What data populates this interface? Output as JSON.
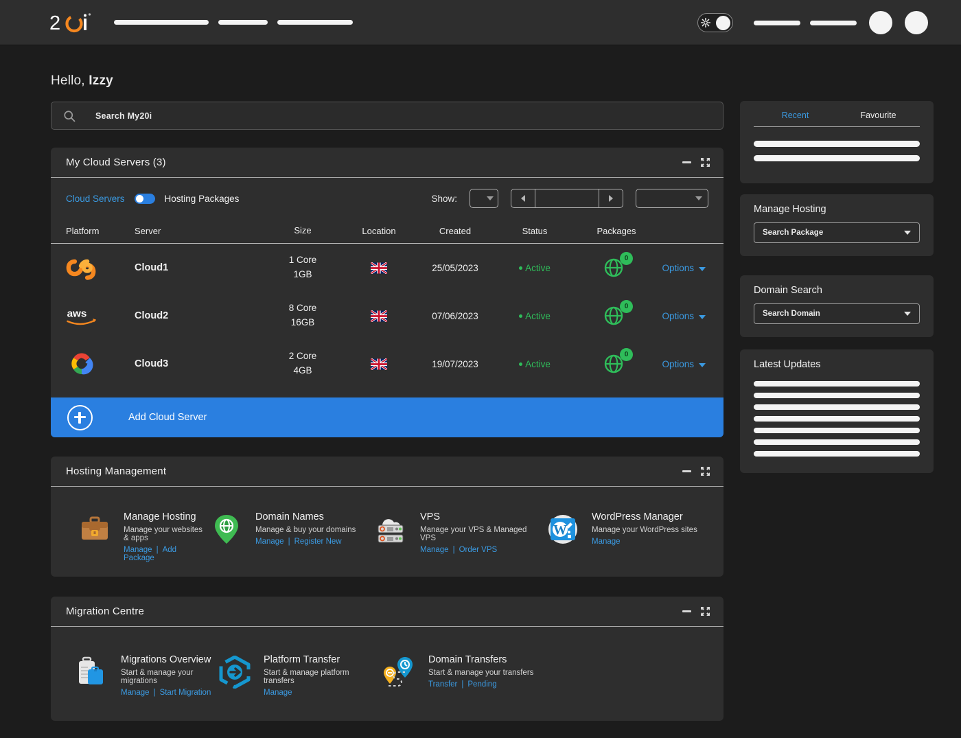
{
  "brand": {
    "logo_text": "20i",
    "accent_orange": "#F5871F",
    "accent_blue": "#2A7FE0"
  },
  "topbar": {
    "nav_placeholder_widths": [
      138,
      72,
      110
    ],
    "right_placeholder_widths": [
      68,
      68
    ],
    "theme_toggle_name": "theme-toggle",
    "avatars": 2
  },
  "greeting": {
    "prefix": "Hello, ",
    "name": "Izzy"
  },
  "search": {
    "placeholder": "Search My20i",
    "value": ""
  },
  "cloud_panel": {
    "title": "My Cloud Servers (3)",
    "toggle_left_label": "Cloud Servers",
    "toggle_right_label": "Hosting Packages",
    "show_label": "Show:",
    "show_value": "",
    "page_value": "",
    "filter_value": "",
    "columns": [
      "Platform",
      "Server",
      "Size",
      "Location",
      "Created",
      "Status",
      "Packages"
    ],
    "rows": [
      {
        "platform": "twentyi-cloud",
        "server": "Cloud1",
        "cores": "1 Core",
        "ram": "1GB",
        "location": "GB",
        "created": "25/05/2023",
        "status": "Active",
        "packages": "0",
        "options": "Options"
      },
      {
        "platform": "aws",
        "server": "Cloud2",
        "cores": "8 Core",
        "ram": "16GB",
        "location": "GB",
        "created": "07/06/2023",
        "status": "Active",
        "packages": "0",
        "options": "Options"
      },
      {
        "platform": "google-cloud",
        "server": "Cloud3",
        "cores": "2 Core",
        "ram": "4GB",
        "location": "GB",
        "created": "19/07/2023",
        "status": "Active",
        "packages": "0",
        "options": "Options"
      }
    ],
    "add_label": "Add Cloud Server"
  },
  "hosting_management": {
    "title": "Hosting Management",
    "tiles": [
      {
        "icon": "briefcase-icon",
        "title": "Manage Hosting",
        "sub": "Manage your websites & apps",
        "link1": "Manage",
        "link2": "Add Package"
      },
      {
        "icon": "map-pin-globe-icon",
        "title": "Domain Names",
        "sub": "Manage & buy your domains",
        "link1": "Manage",
        "link2": "Register New"
      },
      {
        "icon": "vps-server-icon",
        "title": "VPS",
        "sub": "Manage your VPS & Managed VPS",
        "link1": "Manage",
        "link2": "Order VPS"
      },
      {
        "icon": "wordpress-icon",
        "title": "WordPress Manager",
        "sub": "Manage your WordPress sites",
        "link1": "Manage",
        "link2": ""
      }
    ]
  },
  "migration_centre": {
    "title": "Migration Centre",
    "tiles": [
      {
        "icon": "suitcases-icon",
        "title": "Migrations Overview",
        "sub": "Start & manage your migrations",
        "link1": "Manage",
        "link2": "Start Migration"
      },
      {
        "icon": "hexagon-arrow-icon",
        "title": "Platform Transfer",
        "sub": "Start & manage platform transfers",
        "link1": "Manage",
        "link2": ""
      },
      {
        "icon": "domain-pins-icon",
        "title": "Domain Transfers",
        "sub": "Start & manage your transfers",
        "link1": "Transfer",
        "link2": "Pending"
      }
    ]
  },
  "sidebar": {
    "recent_card": {
      "tab_recent": "Recent",
      "tab_favourite": "Favourite",
      "skeleton_rows": 2
    },
    "manage_hosting": {
      "title": "Manage Hosting",
      "select_value": "Search Package"
    },
    "domain_search": {
      "title": "Domain Search",
      "select_value": "Search Domain"
    },
    "latest_updates": {
      "title": "Latest Updates",
      "skeleton_rows": 7
    }
  }
}
